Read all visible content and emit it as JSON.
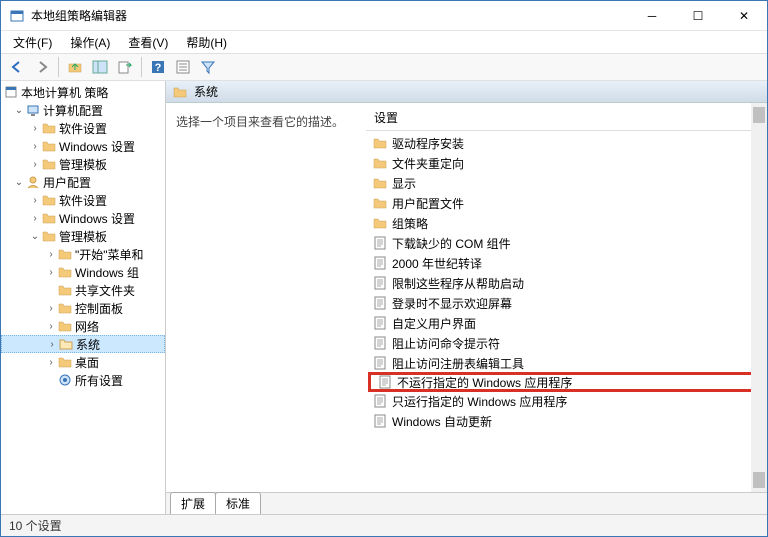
{
  "window": {
    "title": "本地组策略编辑器",
    "min": "─",
    "max": "☐",
    "close": "✕"
  },
  "menu": {
    "file": "文件(F)",
    "action": "操作(A)",
    "view": "查看(V)",
    "help": "帮助(H)"
  },
  "tree": {
    "root": "本地计算机 策略",
    "computer": "计算机配置",
    "software1": "软件设置",
    "windows1": "Windows 设置",
    "admin1": "管理模板",
    "user": "用户配置",
    "software2": "软件设置",
    "windows2": "Windows 设置",
    "admin2": "管理模板",
    "startmenu": "\"开始\"菜单和",
    "wincomp": "Windows 组",
    "sharedf": "共享文件夹",
    "ctrlpanel": "控制面板",
    "network": "网络",
    "system": "系统",
    "desktop": "桌面",
    "allsettings": "所有设置"
  },
  "right": {
    "header": "系统",
    "desc": "选择一个项目来查看它的描述。",
    "colheader": "设置",
    "items": [
      {
        "type": "folder",
        "label": "驱动程序安装"
      },
      {
        "type": "folder",
        "label": "文件夹重定向"
      },
      {
        "type": "folder",
        "label": "显示"
      },
      {
        "type": "folder",
        "label": "用户配置文件"
      },
      {
        "type": "folder",
        "label": "组策略"
      },
      {
        "type": "setting",
        "label": "下载缺少的 COM 组件"
      },
      {
        "type": "setting",
        "label": "2000 年世纪转译"
      },
      {
        "type": "setting",
        "label": "限制这些程序从帮助启动"
      },
      {
        "type": "setting",
        "label": "登录时不显示欢迎屏幕"
      },
      {
        "type": "setting",
        "label": "自定义用户界面"
      },
      {
        "type": "setting",
        "label": "阻止访问命令提示符"
      },
      {
        "type": "setting",
        "label": "阻止访问注册表编辑工具"
      },
      {
        "type": "setting",
        "label": "不运行指定的 Windows 应用程序",
        "hl": true
      },
      {
        "type": "setting",
        "label": "只运行指定的 Windows 应用程序"
      },
      {
        "type": "setting",
        "label": "Windows 自动更新"
      }
    ]
  },
  "tabs": {
    "ext": "扩展",
    "std": "标准"
  },
  "status": "10 个设置"
}
